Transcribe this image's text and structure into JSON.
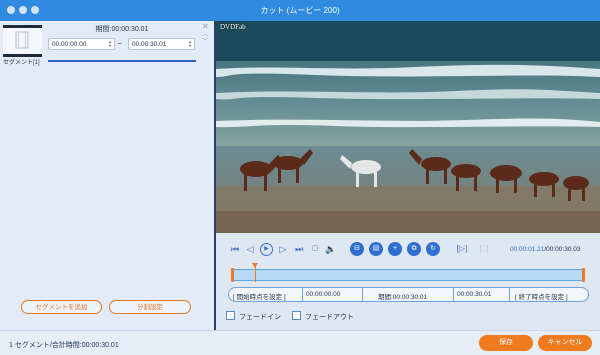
{
  "window": {
    "title": "カット (ムービー 200)"
  },
  "left_panel": {
    "segment_label": "セグメント[1]",
    "duration_label": "期間:00:00:30.01",
    "start_time": "00:00:00.00",
    "end_time": "00:00:30.01",
    "range_dash": "–",
    "add_segment_label": "セグメントを追加",
    "split_label": "分割設定"
  },
  "video": {
    "watermark": "DVDFab"
  },
  "player": {
    "current_time": "00:00:01.21",
    "total_time": "/00:00:30.03"
  },
  "timeline": {
    "progress": 0.065
  },
  "fields": {
    "set_start_label": "開始時点を設定",
    "start_value": "00:00:00.00",
    "duration_label": "期間:00:00:30.01",
    "end_value": "00:00:30.01",
    "set_end_label": "終了時点を設定"
  },
  "options": {
    "fade_in_label": "フェードイン",
    "fade_out_label": "フェードアウト",
    "fade_in_checked": false,
    "fade_out_checked": false
  },
  "footer": {
    "status": "1 セグメント/合計時間:00:00:30.01",
    "save_label": "保存",
    "cancel_label": "キャンセル"
  },
  "colors": {
    "accent": "#2f8ae0",
    "orange": "#f07a1e"
  }
}
